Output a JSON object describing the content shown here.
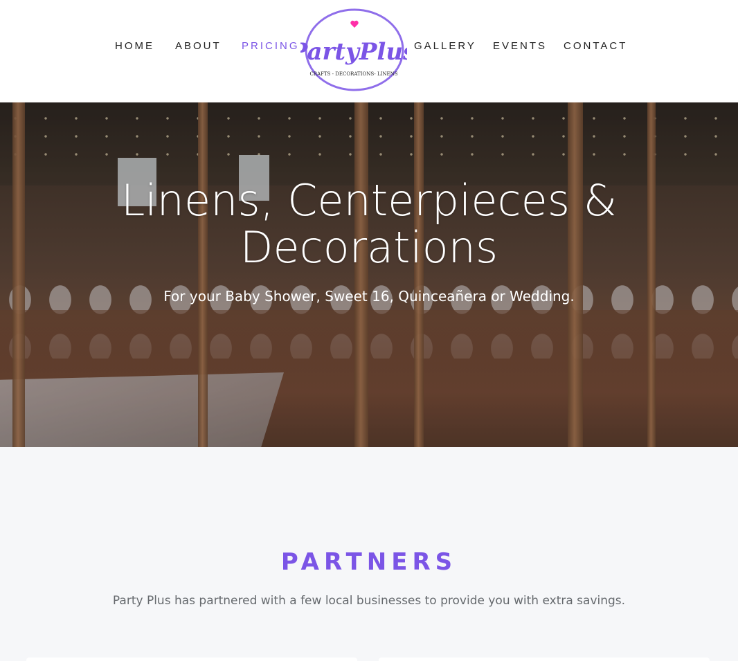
{
  "nav": {
    "items": [
      {
        "label": "HOME",
        "active": false
      },
      {
        "label": "ABOUT",
        "active": false
      },
      {
        "label": "PRICING",
        "active": true
      },
      {
        "label": "GALLERY",
        "active": false
      },
      {
        "label": "EVENTS",
        "active": false
      },
      {
        "label": "CONTACT",
        "active": false
      }
    ]
  },
  "logo": {
    "wordmark": "PartyPlus",
    "tagline": "CRAFTS - DECORATIONS- LINENS",
    "colors": {
      "brand": "#7b55e6",
      "heart": "#ff2fa8"
    }
  },
  "hero": {
    "title_line1": "Linens, Centerpieces &",
    "title_line2": "Decorations",
    "subtitle": "For your Baby Shower, Sweet 16, Quinceañera or Wedding."
  },
  "partners": {
    "title": "PARTNERS",
    "description": "Party Plus has partnered with a few local businesses to provide you with extra savings."
  },
  "colors": {
    "accent": "#7b55e6",
    "section_bg": "#f6f7f9"
  }
}
